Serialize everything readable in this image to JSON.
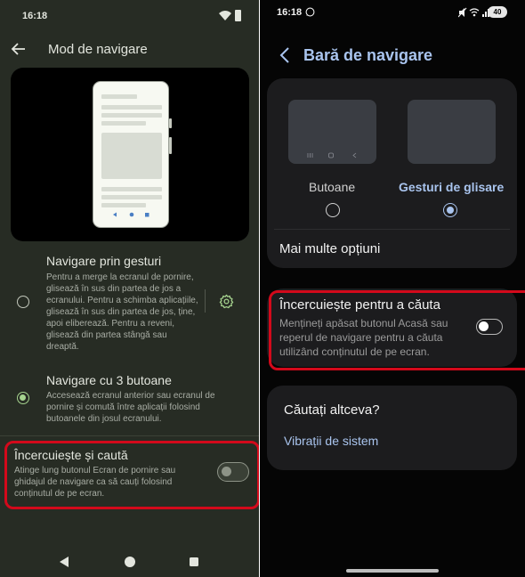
{
  "left": {
    "status": {
      "time": "16:18"
    },
    "header": {
      "title": "Mod de navigare"
    },
    "options": [
      {
        "title": "Navigare prin gesturi",
        "description": "Pentru a merge la ecranul de pornire, glisează în sus din partea de jos a ecranului. Pentru a schimba aplicațiile, glisează în sus din partea de jos, ține, apoi eliberează. Pentru a reveni, glisează din partea stângă sau dreaptă.",
        "selected": false
      },
      {
        "title": "Navigare cu 3 butoane",
        "description": "Accesează ecranul anterior sau ecranul de pornire și comută între aplicații folosind butoanele din josul ecranului.",
        "selected": true
      }
    ],
    "circle_to_search": {
      "title": "Încercuiește și caută",
      "description": "Atinge lung butonul Ecran de pornire sau ghidajul de navigare ca să cauți folosind conținutul de pe ecran.",
      "enabled": false
    }
  },
  "right": {
    "status": {
      "time": "16:18",
      "battery": "40"
    },
    "header": {
      "title": "Bară de navigare"
    },
    "nav_types": [
      {
        "label": "Butoane",
        "selected": false
      },
      {
        "label": "Gesturi de glisare",
        "selected": true
      }
    ],
    "more_options": "Mai multe opțiuni",
    "circle_to_search": {
      "title": "Încercuiește pentru a căuta",
      "description": "Mențineți apăsat butonul Acasă sau reperul de navigare pentru a căuta utilizând conținutul de pe ecran.",
      "enabled": false
    },
    "suggestions": {
      "title": "Căutați altceva?",
      "link": "Vibrații de sistem"
    }
  },
  "colors": {
    "left_bg": "#272c24",
    "right_bg": "#050505",
    "pixel_accent": "#a6d48f",
    "samsung_accent": "#a9c4ee",
    "highlight": "#d3091b"
  }
}
